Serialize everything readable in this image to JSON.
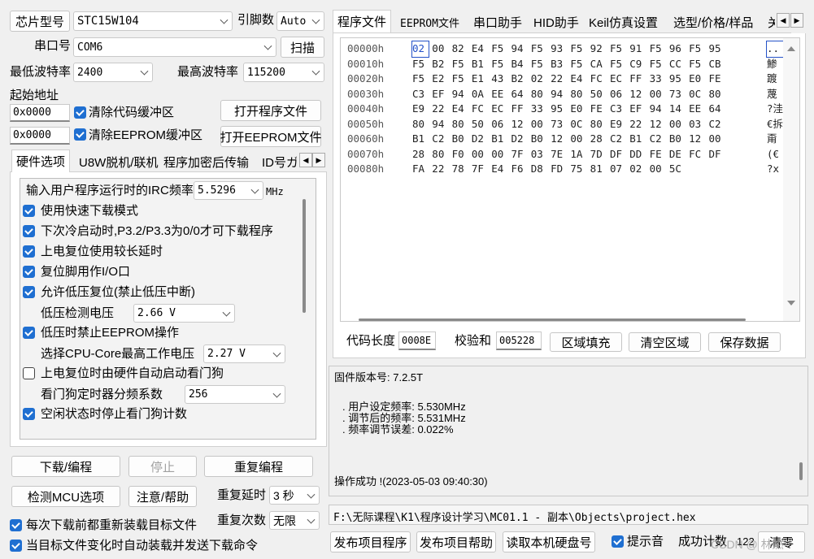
{
  "top": {
    "chip_label": "芯片型号",
    "chip_value": "STC15W104",
    "pins_label": "引脚数",
    "pins_value": "Auto",
    "port_label": "串口号",
    "port_value": "COM6",
    "scan_button": "扫描",
    "min_baud_label": "最低波特率",
    "min_baud_value": "2400",
    "max_baud_label": "最高波特率",
    "max_baud_value": "115200",
    "start_addr_label": "起始地址",
    "addr1_value": "0x0000",
    "clear_code_label": "清除代码缓冲区",
    "open_program_button": "打开程序文件",
    "addr2_value": "0x0000",
    "clear_eeprom_label": "清除EEPROM缓冲区",
    "open_eeprom_button": "打开EEPROM文件"
  },
  "left_tabs": [
    "硬件选项",
    "U8W脱机/联机",
    "程序加密后传输",
    "ID号ガ"
  ],
  "options": {
    "irc_label": "输入用户程序运行时的IRC频率",
    "irc_value": "5.5296",
    "irc_unit": "MHz",
    "checks": [
      {
        "label": "使用快速下载模式",
        "checked": true
      },
      {
        "label": "下次冷启动时,P3.2/P3.3为0/0才可下载程序",
        "checked": true
      },
      {
        "label": "上电复位使用较长延时",
        "checked": true
      },
      {
        "label": "复位脚用作I/O口",
        "checked": true
      },
      {
        "label": "允许低压复位(禁止低压中断)",
        "checked": true
      }
    ],
    "lv_label": "低压检测电压",
    "lv_value": "2.66 V",
    "eeprom_check_label": "低压时禁止EEPROM操作",
    "cpu_label": "选择CPU-Core最高工作电压",
    "cpu_value": "2.27 V",
    "wdt_check_label": "上电复位时由硬件自动启动看门狗",
    "wdt_div_label": "看门狗定时器分频系数",
    "wdt_div_value": "256",
    "idle_check_label": "空闲状态时停止看门狗计数"
  },
  "bottom_left": {
    "download_button": "下载/编程",
    "stop_button": "停止",
    "reprogram_button": "重复编程",
    "detect_button": "检测MCU选项",
    "help_button": "注意/帮助",
    "delay_label": "重复延时",
    "delay_value": "3 秒",
    "count_label": "重复次数",
    "count_value": "无限",
    "reload_label": "每次下载前都重新装载目标文件",
    "auto_label": "当目标文件变化时自动装载并发送下载命令"
  },
  "right_tabs": [
    "程序文件",
    "EEPROM文件",
    "串口助手",
    "HID助手",
    "Keil仿真设置",
    "选型/价格/样品",
    "关"
  ],
  "hex": {
    "rows": [
      {
        "addr": "00000h",
        "bytes": [
          "02",
          "00",
          "82",
          "E4",
          "F5",
          "94",
          "F5",
          "93",
          "F5",
          "92",
          "F5",
          "91",
          "F5",
          "96",
          "F5",
          "95"
        ],
        "ascii": ".."
      },
      {
        "addr": "00010h",
        "bytes": [
          "F5",
          "B2",
          "F5",
          "B1",
          "F5",
          "B4",
          "F5",
          "B3",
          "F5",
          "CA",
          "F5",
          "C9",
          "F5",
          "CC",
          "F5",
          "CB"
        ],
        "ascii": "鯵"
      },
      {
        "addr": "00020h",
        "bytes": [
          "F5",
          "E2",
          "F5",
          "E1",
          "43",
          "B2",
          "02",
          "22",
          "E4",
          "FC",
          "EC",
          "FF",
          "33",
          "95",
          "E0",
          "FE"
        ],
        "ascii": "踱"
      },
      {
        "addr": "00030h",
        "bytes": [
          "C3",
          "EF",
          "94",
          "0A",
          "EE",
          "64",
          "80",
          "94",
          "80",
          "50",
          "06",
          "12",
          "00",
          "73",
          "0C",
          "80"
        ],
        "ascii": "蔑"
      },
      {
        "addr": "00040h",
        "bytes": [
          "E9",
          "22",
          "E4",
          "FC",
          "EC",
          "FF",
          "33",
          "95",
          "E0",
          "FE",
          "C3",
          "EF",
          "94",
          "14",
          "EE",
          "64"
        ],
        "ascii": "?洼"
      },
      {
        "addr": "00050h",
        "bytes": [
          "80",
          "94",
          "80",
          "50",
          "06",
          "12",
          "00",
          "73",
          "0C",
          "80",
          "E9",
          "22",
          "12",
          "00",
          "03",
          "C2"
        ],
        "ascii": "€拆"
      },
      {
        "addr": "00060h",
        "bytes": [
          "B1",
          "C2",
          "B0",
          "D2",
          "B1",
          "D2",
          "B0",
          "12",
          "00",
          "28",
          "C2",
          "B1",
          "C2",
          "B0",
          "12",
          "00"
        ],
        "ascii": "甭"
      },
      {
        "addr": "00070h",
        "bytes": [
          "28",
          "80",
          "F0",
          "00",
          "00",
          "7F",
          "03",
          "7E",
          "1A",
          "7D",
          "DF",
          "DD",
          "FE",
          "DE",
          "FC",
          "DF"
        ],
        "ascii": "(€"
      },
      {
        "addr": "00080h",
        "bytes": [
          "FA",
          "22",
          "78",
          "7F",
          "E4",
          "F6",
          "D8",
          "FD",
          "75",
          "81",
          "07",
          "02",
          "00",
          "5C"
        ],
        "ascii": "?x"
      }
    ]
  },
  "code_bar": {
    "len_label": "代码长度",
    "len_value": "0008E",
    "sum_label": "校验和",
    "sum_value": "005228",
    "fill_button": "区域填充",
    "clear_button": "清空区域",
    "save_button": "保存数据"
  },
  "log": {
    "lines": [
      "固件版本号: 7.2.5T",
      "",
      ". 用户设定频率: 5.530MHz",
      ". 调节后的频率: 5.531MHz",
      ". 频率调节误差: 0.022%",
      "",
      "",
      "操作成功 !(2023-05-03 09:40:30)"
    ]
  },
  "path": "F:\\无际课程\\K1\\程序设计学习\\MC01.1 - 副本\\Objects\\project.hex",
  "footer": {
    "publish_prog_button": "发布项目程序",
    "publish_help_button": "发布项目帮助",
    "read_disk_button": "读取本机硬盘号",
    "hint_label": "提示音",
    "success_label": "成功计数",
    "success_value": "122",
    "clear_button": "清零",
    "watermark": "CSDN @ 林燃"
  }
}
